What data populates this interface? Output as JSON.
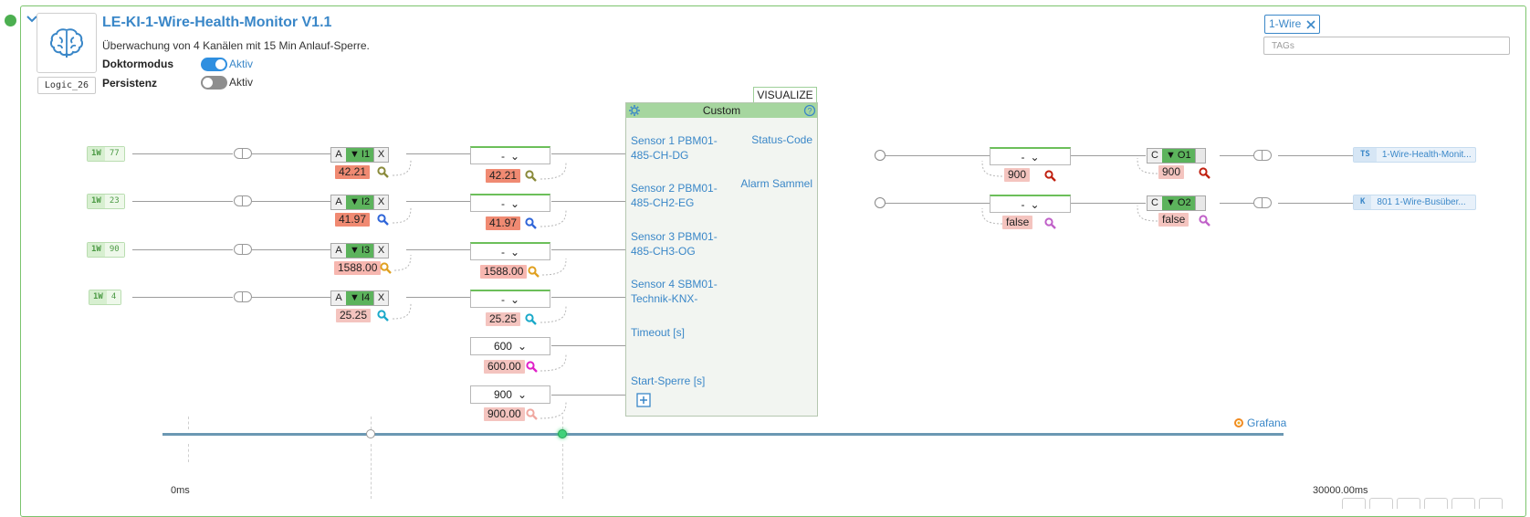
{
  "header": {
    "title": "LE-KI-1-Wire-Health-Monitor V1.1",
    "subtitle": "Überwachung von 4 Kanälen mit 15 Min Anlauf-Sperre.",
    "logic_id": "Logic_26",
    "properties": [
      {
        "label": "Doktormodus",
        "state": "Aktiv",
        "on": true
      },
      {
        "label": "Persistenz",
        "state": "Aktiv",
        "on": false
      }
    ]
  },
  "tags": {
    "chips": [
      "1-Wire"
    ],
    "placeholder": "TAGs"
  },
  "inputs": [
    {
      "source_proto": "1W",
      "source_num": "77",
      "filter_a": "A",
      "filter_id": "I1",
      "filter_x": "X",
      "raw_value": "42.21",
      "dropdown": "-",
      "value": "42.21",
      "port_label": "Sensor 1 PBM01-485-CH-DG"
    },
    {
      "source_proto": "1W",
      "source_num": "23",
      "filter_a": "A",
      "filter_id": "I2",
      "filter_x": "X",
      "raw_value": "41.97",
      "dropdown": "-",
      "value": "41.97",
      "port_label": "Sensor 2 PBM01-485-CH2-EG"
    },
    {
      "source_proto": "1W",
      "source_num": "90",
      "filter_a": "A",
      "filter_id": "I3",
      "filter_x": "X",
      "raw_value": "1588.00",
      "dropdown": "-",
      "value": "1588.00",
      "port_label": "Sensor 3 PBM01-485-CH3-OG"
    },
    {
      "source_proto": "1W",
      "source_num": "4",
      "filter_a": "A",
      "filter_id": "I4",
      "filter_x": "X",
      "raw_value": "25.25",
      "dropdown": "-",
      "value": "25.25",
      "port_label": "Sensor 4 SBM01-Technik-KNX-"
    },
    {
      "dropdown": "600",
      "value": "600.00",
      "port_label": "Timeout [s]"
    },
    {
      "dropdown": "900",
      "value": "900.00",
      "port_label": "Start-Sperre [s]"
    }
  ],
  "block": {
    "title": "Custom",
    "visualize_label": "VISUALIZE",
    "outputs": [
      "Status-Code",
      "Alarm Sammel"
    ]
  },
  "outputs": [
    {
      "dropdown": "-",
      "value": "900",
      "filter_c": "C",
      "filter_id": "O1",
      "filter_value": "900",
      "dest_type": "TS",
      "dest_name": "1-Wire-Health-Monit..."
    },
    {
      "dropdown": "-",
      "value": "false",
      "filter_c": "C",
      "filter_id": "O2",
      "filter_value": "false",
      "dest_type": "K",
      "dest_name": "801 1-Wire-Busüber..."
    }
  ],
  "timeline": {
    "start_label": "0ms",
    "end_label": "30000.00ms",
    "grafana_label": "Grafana"
  },
  "colors": {
    "accent_blue": "#3a87c8",
    "panel_green": "#7cc46e",
    "filter_green": "#5cb35c",
    "value_red": "#f08a72"
  }
}
